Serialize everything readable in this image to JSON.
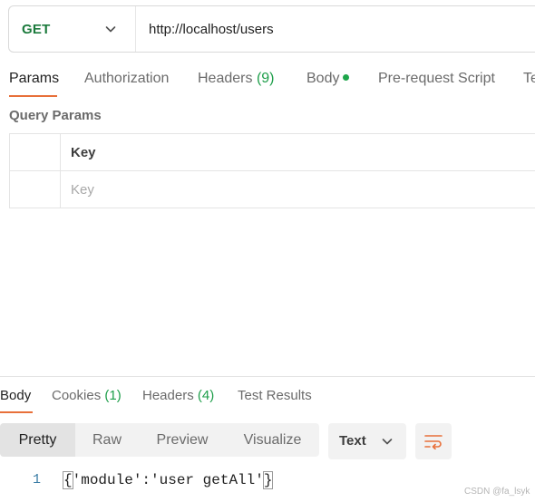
{
  "request": {
    "method": "GET",
    "url": "http://localhost/users"
  },
  "request_tabs": [
    {
      "label": "Params",
      "active": true
    },
    {
      "label": "Authorization"
    },
    {
      "label": "Headers",
      "count": "(9)"
    },
    {
      "label": "Body",
      "indicator": "green-dot"
    },
    {
      "label": "Pre-request Script"
    },
    {
      "label": "Te"
    }
  ],
  "query_params": {
    "title": "Query Params",
    "header_key": "Key",
    "placeholder_key": "Key"
  },
  "response_tabs": [
    {
      "label": "Body",
      "active": true
    },
    {
      "label": "Cookies",
      "count": "(1)"
    },
    {
      "label": "Headers",
      "count": "(4)"
    },
    {
      "label": "Test Results"
    }
  ],
  "view_options": [
    "Pretty",
    "Raw",
    "Preview",
    "Visualize"
  ],
  "active_view": "Pretty",
  "format": "Text",
  "icons": {
    "method_dropdown": "chevron-down-icon",
    "format_dropdown": "chevron-down-icon",
    "wrap": "wrap-lines-icon"
  },
  "response_body": {
    "line_number": "1",
    "open_brace": "{",
    "content": "'module':'user getAll'",
    "close_brace": "}"
  },
  "watermark": "CSDN @fa_lsyk",
  "colors": {
    "accent": "#e8703a",
    "method": "#1b7a3c",
    "count": "#1e9e4a"
  }
}
